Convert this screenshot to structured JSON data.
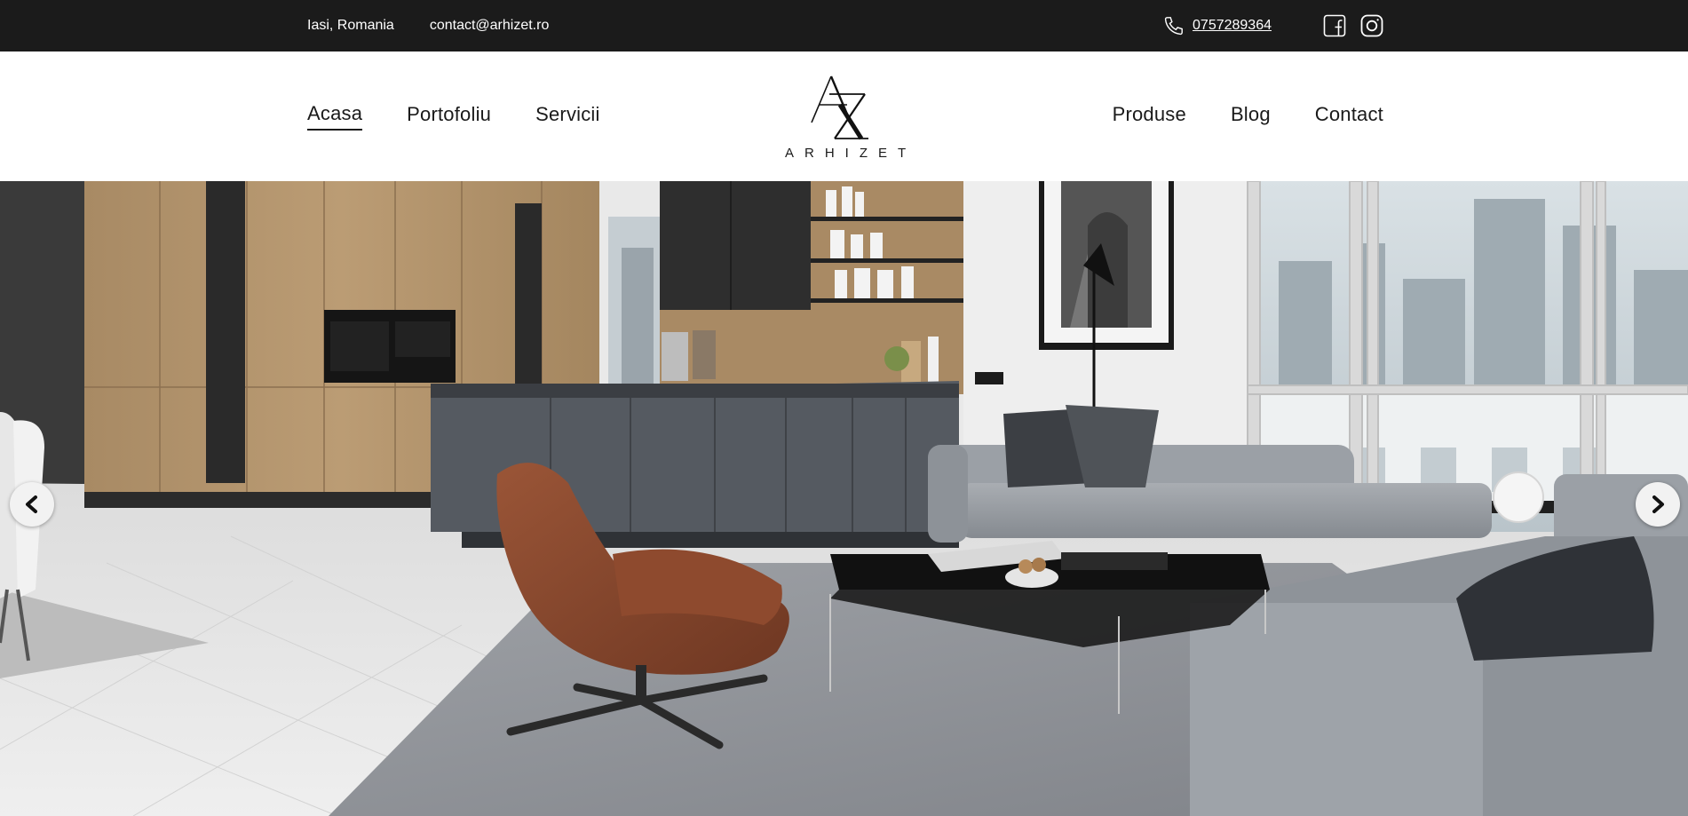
{
  "topbar": {
    "location": "Iasi, Romania",
    "email": "contact@arhizet.ro",
    "phone": "0757289364",
    "phone_icon": "phone-icon",
    "social_icons": [
      "facebook-icon",
      "instagram-icon"
    ]
  },
  "nav": {
    "left": [
      {
        "label": "Acasa",
        "active": true
      },
      {
        "label": "Portofoliu",
        "active": false
      },
      {
        "label": "Servicii",
        "active": false
      }
    ],
    "right": [
      {
        "label": "Produse",
        "active": false
      },
      {
        "label": "Blog",
        "active": false
      },
      {
        "label": "Contact",
        "active": false
      }
    ]
  },
  "logo": {
    "monogram": "AZ",
    "wordmark": "ARHIZET"
  },
  "hero": {
    "prev_icon": "chevron-left-icon",
    "next_icon": "chevron-right-icon"
  },
  "colors": {
    "topbar_bg": "#1b1b1b",
    "text": "#1a1a1a",
    "white": "#ffffff"
  }
}
